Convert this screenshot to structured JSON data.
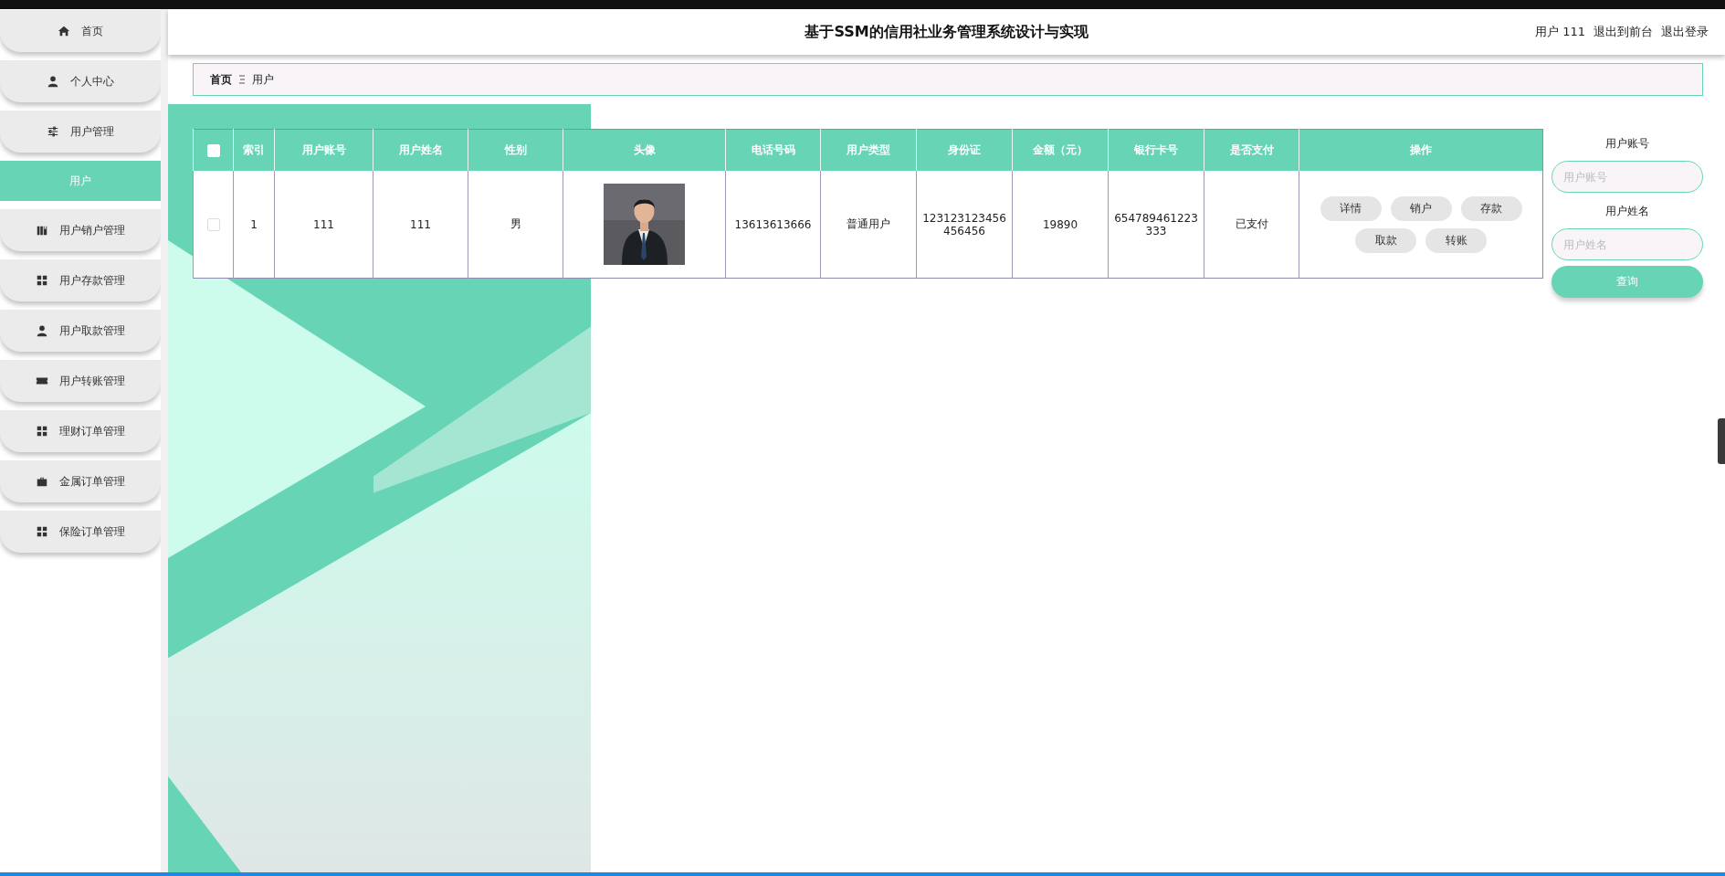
{
  "header": {
    "title": "基于SSM的信用社业务管理系统设计与实现",
    "user": "用户 111",
    "links": [
      "退出到前台",
      "退出登录"
    ]
  },
  "sidebar": {
    "items": [
      {
        "label": "首页",
        "selected": false
      },
      {
        "label": "个人中心",
        "selected": false
      },
      {
        "label": "用户管理",
        "selected": false,
        "expanded": true,
        "children": [
          {
            "label": "用户",
            "selected": true
          }
        ]
      },
      {
        "label": "用户销户管理",
        "selected": false
      },
      {
        "label": "用户存款管理",
        "selected": false
      },
      {
        "label": "用户取款管理",
        "selected": false
      },
      {
        "label": "用户转账管理",
        "selected": false
      },
      {
        "label": "理财订单管理",
        "selected": false
      },
      {
        "label": "金属订单管理",
        "selected": false
      },
      {
        "label": "保险订单管理",
        "selected": false
      }
    ]
  },
  "breadcrumb": [
    "首页",
    "用户"
  ],
  "table": {
    "select_all": false,
    "columns": [
      "索引",
      "用户账号",
      "用户姓名",
      "性别",
      "头像",
      "电话号码",
      "用户类型",
      "身份证",
      "金额（元）",
      "银行卡号",
      "是否支付",
      "操作"
    ],
    "rows": [
      {
        "checked": false,
        "cells": [
          "1",
          "111",
          "111",
          "男",
          {
            "kind": "picture"
          },
          "13613613666",
          "普通用户",
          "123123123456456456",
          "19890",
          "654789461223333",
          "已支付"
        ],
        "actions": [
          "详情",
          "销户",
          "存款",
          "取款",
          "转账"
        ]
      }
    ]
  },
  "search": {
    "fields": [
      {
        "label": "用户账号",
        "placeholder": "用户账号"
      },
      {
        "label": "用户姓名",
        "placeholder": "用户姓名"
      }
    ],
    "button": "查询"
  }
}
